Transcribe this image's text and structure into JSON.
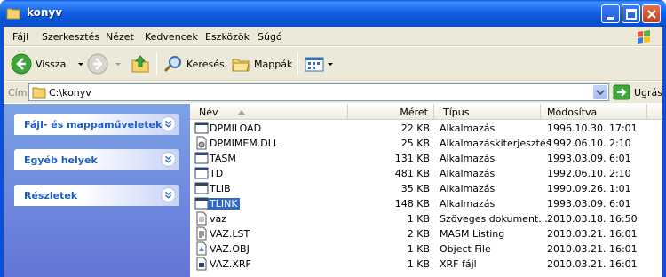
{
  "window": {
    "title": "konyv"
  },
  "menu": [
    "Fájl",
    "Szerkesztés",
    "Nézet",
    "Kedvencek",
    "Eszközök",
    "Súgó"
  ],
  "toolbar": {
    "back_label": "Vissza",
    "search_label": "Keresés",
    "folders_label": "Mappák"
  },
  "address": {
    "label": "Cím",
    "value": "C:\\konyv",
    "go_label": "Ugrás"
  },
  "tasks": [
    "Fájl- és mappaműveletek",
    "Egyéb helyek",
    "Részletek"
  ],
  "columns": {
    "name": "Név",
    "size": "Méret",
    "type": "Típus",
    "modified": "Módosítva"
  },
  "files": [
    {
      "name": "DPMILOAD",
      "size": "22 KB",
      "type": "Alkalmazás",
      "modified": "1996.10.30. 17:01",
      "icon": "application-icon"
    },
    {
      "name": "DPMIMEM.DLL",
      "size": "25 KB",
      "type": "Alkalmazáskiterjesztés",
      "modified": "1992.06.10. 2:10",
      "icon": "dll-icon"
    },
    {
      "name": "TASM",
      "size": "131 KB",
      "type": "Alkalmazás",
      "modified": "1993.03.09. 6:01",
      "icon": "application-icon"
    },
    {
      "name": "TD",
      "size": "481 KB",
      "type": "Alkalmazás",
      "modified": "1992.06.10. 2:10",
      "icon": "application-icon"
    },
    {
      "name": "TLIB",
      "size": "35 KB",
      "type": "Alkalmazás",
      "modified": "1990.09.26. 1:01",
      "icon": "application-icon"
    },
    {
      "name": "TLINK",
      "size": "148 KB",
      "type": "Alkalmazás",
      "modified": "1993.03.09. 6:01",
      "icon": "application-icon",
      "selected": true
    },
    {
      "name": "vaz",
      "size": "1 KB",
      "type": "Szöveges dokument...",
      "modified": "2010.03.18. 16:50",
      "icon": "text-file-icon"
    },
    {
      "name": "VAZ.LST",
      "size": "2 KB",
      "type": "MASM Listing",
      "modified": "2010.03.21. 16:01",
      "icon": "listing-file-icon"
    },
    {
      "name": "VAZ.OBJ",
      "size": "1 KB",
      "type": "Object File",
      "modified": "2010.03.21. 16:01",
      "icon": "object-file-icon"
    },
    {
      "name": "VAZ.XRF",
      "size": "1 KB",
      "type": "XRF fájl",
      "modified": "2010.03.21. 16:01",
      "icon": "xrf-file-icon"
    }
  ]
}
